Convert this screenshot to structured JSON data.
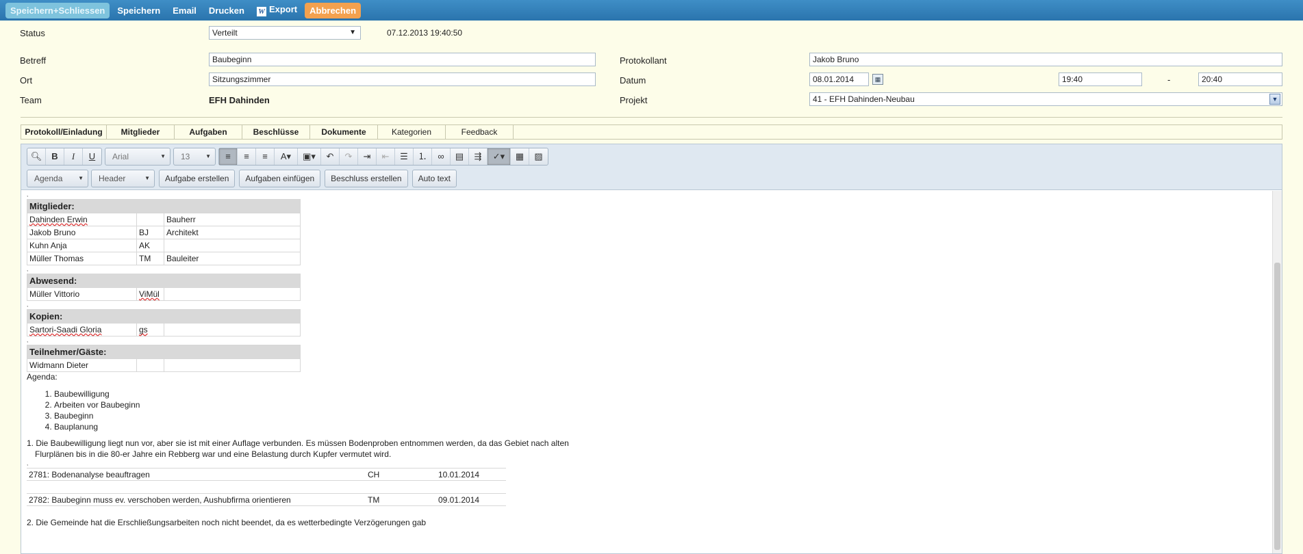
{
  "toolbar": {
    "save_close": "Speichern+Schliessen",
    "save": "Speichern",
    "email": "Email",
    "print": "Drucken",
    "export": "Export",
    "cancel": "Abbrechen"
  },
  "form": {
    "status_label": "Status",
    "status_value": "Verteilt",
    "timestamp": "07.12.2013 19:40:50",
    "betreff_label": "Betreff",
    "betreff_value": "Baubeginn",
    "ort_label": "Ort",
    "ort_value": "Sitzungszimmer",
    "team_label": "Team",
    "team_value": "EFH Dahinden",
    "protokollant_label": "Protokollant",
    "protokollant_value": "Jakob Bruno",
    "datum_label": "Datum",
    "datum_value": "08.01.2014",
    "time_from": "19:40",
    "time_sep": "-",
    "time_to": "20:40",
    "projekt_label": "Projekt",
    "projekt_value": "41 - EFH Dahinden-Neubau"
  },
  "tabs": [
    "Protokoll/Einladung",
    "Mitglieder",
    "Aufgaben",
    "Beschlüsse",
    "Dokumente",
    "Kategorien",
    "Feedback"
  ],
  "editor_toolbar": {
    "font_family": "Arial",
    "font_size": "13",
    "agenda_dropdown": "Agenda",
    "header_dropdown": "Header",
    "btn_create_task": "Aufgabe erstellen",
    "btn_insert_tasks": "Aufgaben einfügen",
    "btn_create_decision": "Beschluss erstellen",
    "btn_auto_text": "Auto text"
  },
  "document": {
    "members": {
      "title": "Mitglieder:",
      "rows": [
        {
          "name": "Dahinden Erwin",
          "abbr": "",
          "role": "Bauherr"
        },
        {
          "name": "Jakob Bruno",
          "abbr": "BJ",
          "role": "Architekt"
        },
        {
          "name": "Kuhn Anja",
          "abbr": "AK",
          "role": ""
        },
        {
          "name": "Müller Thomas",
          "abbr": "TM",
          "role": "Bauleiter"
        }
      ]
    },
    "absent": {
      "title": "Abwesend:",
      "rows": [
        {
          "name": "Müller Vittorio",
          "abbr": "ViMül",
          "role": ""
        }
      ]
    },
    "copies": {
      "title": "Kopien:",
      "rows": [
        {
          "name": "Sartori-Saadi Gloria",
          "abbr": "gs",
          "role": ""
        }
      ]
    },
    "guests": {
      "title": "Teilnehmer/Gäste:",
      "rows": [
        {
          "name": "Widmann Dieter",
          "abbr": "",
          "role": ""
        }
      ]
    },
    "agenda_label": "Agenda:",
    "agenda_items": [
      "Baubewilligung",
      "Arbeiten vor Baubeginn",
      "Baubeginn",
      "Bauplanung"
    ],
    "para1_line1": "1. Die Baubewilligung liegt nun vor, aber sie ist mit einer Auflage verbunden. Es müssen Bodenproben entnommen werden, da das Gebiet nach alten",
    "para1_line2": "Flurplänen bis in die 80-er Jahre ein Rebberg war und eine Belastung durch Kupfer vermutet wird.",
    "tasks": [
      {
        "text": "2781: Bodenanalyse beauftragen",
        "who": "CH",
        "date": "10.01.2014"
      },
      {
        "text": "2782: Baubeginn muss ev. verschoben werden, Aushubfirma orientieren",
        "who": "TM",
        "date": "09.01.2014"
      }
    ],
    "para2": "2. Die Gemeinde hat die Erschließungsarbeiten noch nicht beendet, da es wetterbedingte Verzögerungen gab"
  }
}
